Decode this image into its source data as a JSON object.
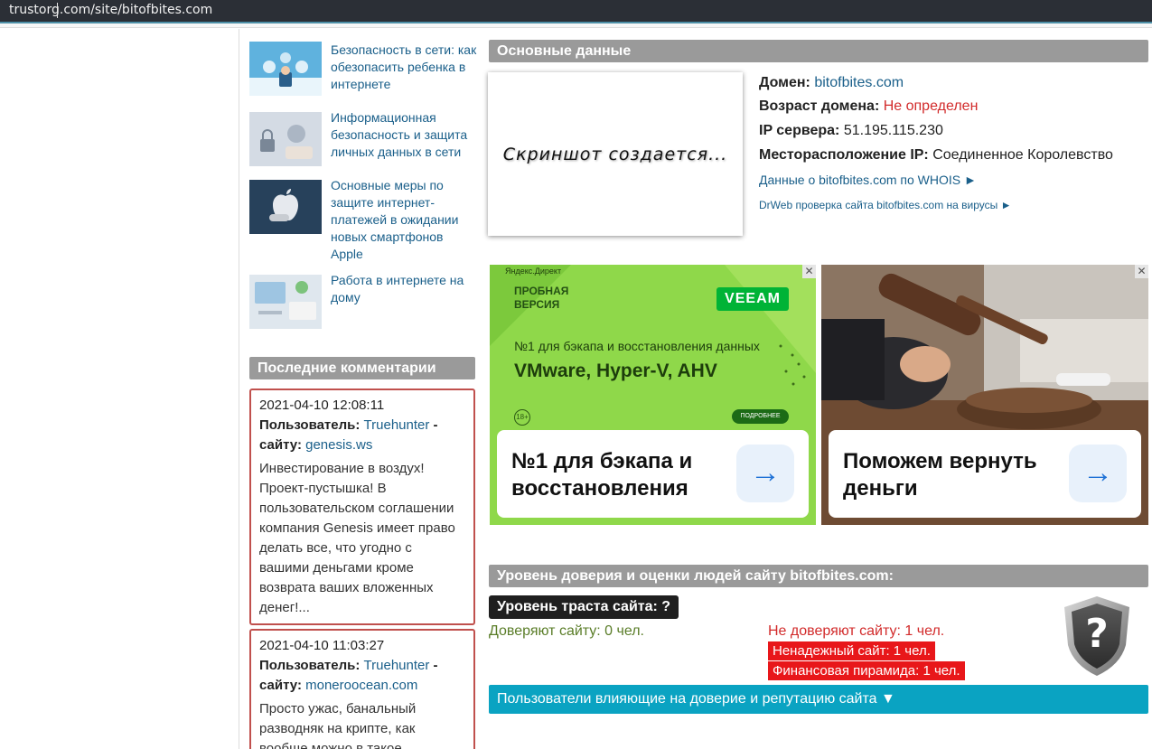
{
  "address_bar": {
    "url": "trustorg.com/site/bitofbites.com"
  },
  "articles": [
    {
      "title": "Безопасность в сети: как обезопасить ребенка в интернете"
    },
    {
      "title": "Информационная безопасность и защита личных данных в сети"
    },
    {
      "title": "Основные меры по защите интернет-платежей в ожидании новых смартфонов Apple"
    },
    {
      "title": "Работа в интернете на дому"
    }
  ],
  "comments_section": {
    "title": "Последние комментарии",
    "user_label": "Пользователь:",
    "site_label": "сайту:",
    "items": [
      {
        "date": "2021-04-10 12:08:11",
        "user": "Truehunter",
        "site": "genesis.ws",
        "text": "Инвестирование в воздух! Проект-пустышка! В пользовательском соглашении компания Genesis имеет право делать все, что угодно с вашими деньгами кроме возврата ваших вложенных денег!..."
      },
      {
        "date": "2021-04-10 11:03:27",
        "user": "Truehunter",
        "site": "moneroocean.com",
        "text": "Просто ужас, банальный разводняк на крипте, как вообще можно в такое"
      }
    ]
  },
  "main": {
    "basic_title": "Основные данные",
    "screenshot_text": "Скриншот создается...",
    "domain_label": "Домен:",
    "domain_value": "bitofbites.com",
    "age_label": "Возраст домена:",
    "age_value": "Не определен",
    "ip_label": "IP сервера:",
    "ip_value": "51.195.115.230",
    "location_label": "Месторасположение IP:",
    "location_value": "Соединенное Королевство",
    "whois_link": "Данные о bitofbites.com по WHOIS ►",
    "drweb_link": "DrWeb проверка сайта bitofbites.com на вирусы ►"
  },
  "ads": [
    {
      "label": "Яндекс.Директ",
      "badge": "ПРОБНАЯ ВЕРСИЯ",
      "brand": "VEEAM",
      "headline": "№1 для бэкапа и восстановления данных",
      "products": "VMware, Hyper-V, AHV",
      "age": "18+",
      "more": "ПОДРОБНЕЕ",
      "card_text": "№1 для бэкапа и восстановления",
      "close": "✕",
      "arrow": "→"
    },
    {
      "card_text": "Поможем вернуть деньги",
      "close": "✕",
      "arrow": "→"
    }
  ],
  "trust": {
    "section_title": "Уровень доверия и оценки людей сайту bitofbites.com:",
    "level": "Уровень траста сайта: ?",
    "trust_yes": "Доверяют сайту: 0 чел.",
    "trust_no": "Не доверяют сайту: 1 чел.",
    "badges": [
      "Ненадежный сайт: 1 чел.",
      "Финансовая пирамида: 1 чел."
    ],
    "shield_symbol": "?",
    "users_bar": "Пользователи влияющие на доверие и репутацию сайта ▼"
  },
  "colors": {
    "accent_link": "#1a5f8a",
    "red": "#d22b2b",
    "section_grey": "#9a9a9a",
    "cyan_bar": "#0aa3c2",
    "comment_border": "#c0504d"
  }
}
